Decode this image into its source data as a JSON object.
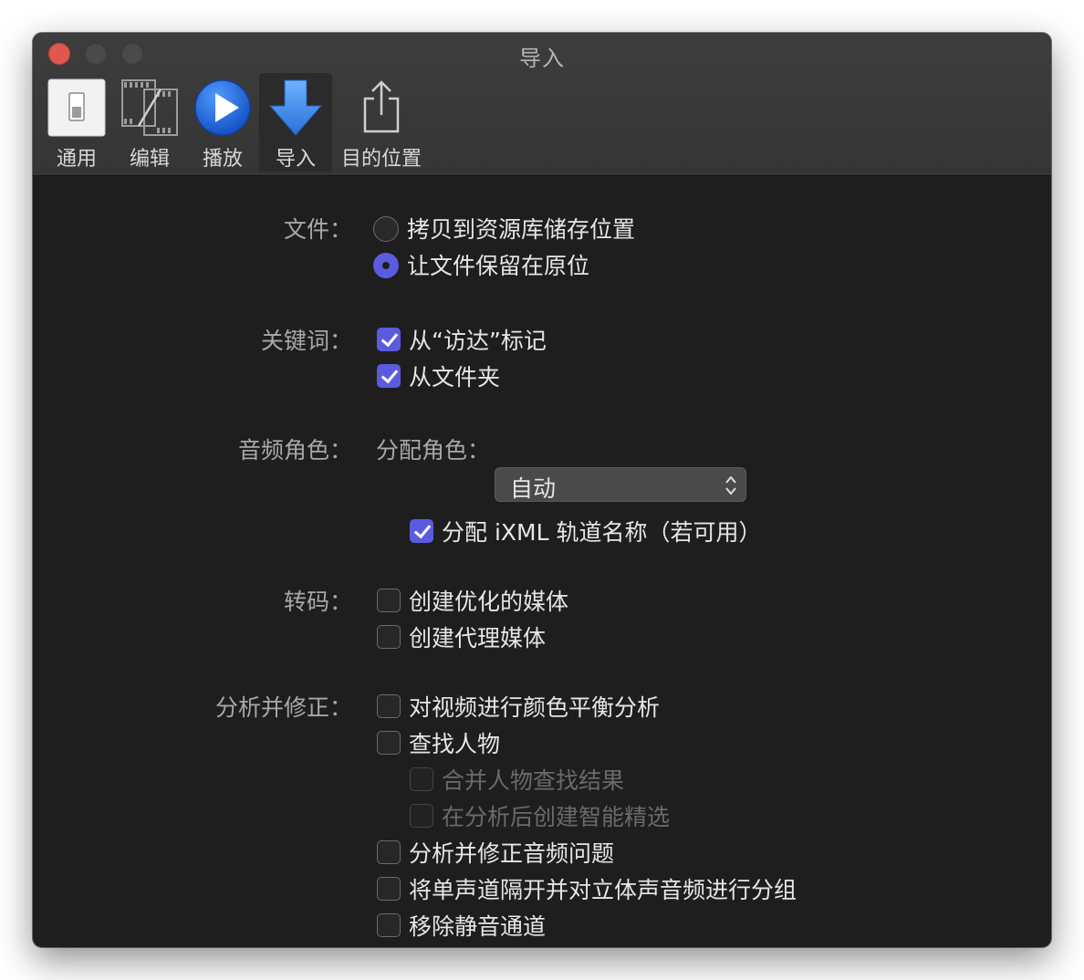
{
  "window": {
    "title": "导入"
  },
  "toolbar": {
    "items": [
      {
        "label": "通用",
        "icon": "switch-icon"
      },
      {
        "label": "编辑",
        "icon": "film-edit-icon"
      },
      {
        "label": "播放",
        "icon": "play-icon"
      },
      {
        "label": "导入",
        "icon": "import-arrow-icon",
        "selected": true
      },
      {
        "label": "目的位置",
        "icon": "share-icon"
      }
    ]
  },
  "files": {
    "label": "文件：",
    "options": [
      {
        "label": "拷贝到资源库储存位置",
        "selected": false
      },
      {
        "label": "让文件保留在原位",
        "selected": true
      }
    ]
  },
  "keywords": {
    "label": "关键词：",
    "options": [
      {
        "label": "从“访达”标记",
        "checked": true
      },
      {
        "label": "从文件夹",
        "checked": true
      }
    ]
  },
  "audio_roles": {
    "label": "音频角色：",
    "assign_label": "分配角色：",
    "assign_value": "自动",
    "ixml": {
      "label": "分配 iXML 轨道名称（若可用）",
      "checked": true
    }
  },
  "transcode": {
    "label": "转码：",
    "options": [
      {
        "label": "创建优化的媒体",
        "checked": false
      },
      {
        "label": "创建代理媒体",
        "checked": false
      }
    ]
  },
  "analyze": {
    "label": "分析并修正：",
    "options": [
      {
        "label": "对视频进行颜色平衡分析",
        "checked": false
      },
      {
        "label": "查找人物",
        "checked": false
      },
      {
        "label": "合并人物查找结果",
        "checked": false,
        "disabled": true
      },
      {
        "label": "在分析后创建智能精选",
        "checked": false,
        "disabled": true
      },
      {
        "label": "分析并修正音频问题",
        "checked": false
      },
      {
        "label": "将单声道隔开并对立体声音频进行分组",
        "checked": false
      },
      {
        "label": "移除静音通道",
        "checked": false
      }
    ]
  },
  "colors": {
    "accent": "#5b5be0",
    "background": "#1e1e1e",
    "close": "#e0574f"
  }
}
